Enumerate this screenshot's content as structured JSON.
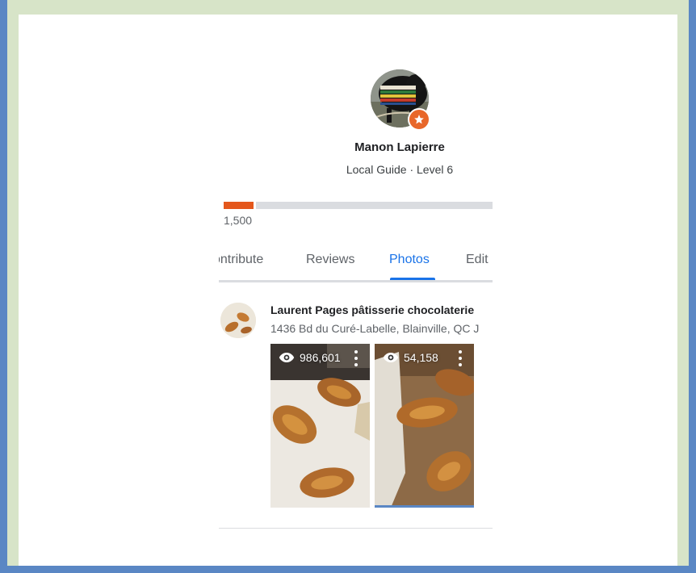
{
  "profile": {
    "name": "Manon Lapierre",
    "level": "Local Guide · Level 6",
    "progress": {
      "label": "1,500",
      "fill_percent": 11
    }
  },
  "tabs": [
    {
      "label": "Contribute",
      "visible_text": "ontribute"
    },
    {
      "label": "Reviews"
    },
    {
      "label": "Photos",
      "active": true
    },
    {
      "label": "Edits",
      "visible_text": "Edit"
    }
  ],
  "place": {
    "name": "Laurent Pages pâtisserie chocolaterie",
    "address": "1436 Bd du Curé-Labelle, Blainville, QC J"
  },
  "photos": [
    {
      "views": "986,601",
      "menu_icon": "more-vert-icon"
    },
    {
      "views": "54,158",
      "menu_icon": "more-vert-icon"
    }
  ],
  "colors": {
    "accent": "#1a73e8",
    "progress": "#e4571c",
    "badge": "#e8672a",
    "frame": "#5a87c4",
    "outer_background": "#d7e4c8"
  }
}
